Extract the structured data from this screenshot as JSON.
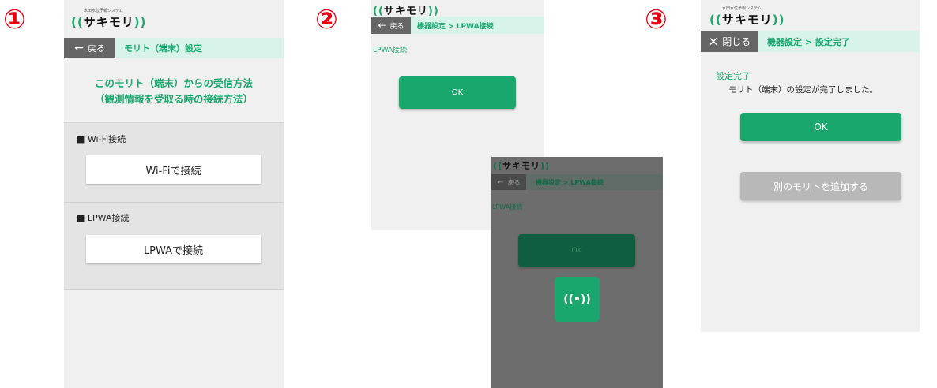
{
  "steps": [
    "①",
    "②",
    "③"
  ],
  "logo": {
    "text": "サキモリ",
    "subtitle": "水田水位予報システム"
  },
  "screen1": {
    "back_label": "戻る",
    "nav_title": "モリト（端末）設定",
    "heading_line1": "このモリト（端末）からの受信方法",
    "heading_line2": "（観測情報を受取る時の接続方法）",
    "wifi_section_label": "Wi-Fi接続",
    "wifi_button": "Wi-Fiで接続",
    "lpwa_section_label": "LPWA接続",
    "lpwa_button": "LPWAで接続"
  },
  "screen2": {
    "back_label": "戻る",
    "nav_title": "機器設定 > LPWA接続",
    "section_label": "LPWA接続",
    "ok_button": "OK"
  },
  "screen2b": {
    "back_label": "戻る",
    "nav_title": "機器設定 > LPWA接続",
    "section_label": "LPWA接続",
    "ok_button": "OK",
    "signal_icon_glyph": "((•))"
  },
  "screen3": {
    "close_label": "閉じる",
    "nav_title": "機器設定 > 設定完了",
    "status_title": "設定完了",
    "status_message": "モリト（端末）の設定が完了しました。",
    "ok_button": "OK",
    "add_button": "別のモリトを追加する"
  },
  "colors": {
    "accent": "#1aa76e",
    "step_number": "#e60012",
    "nav_bg": "#d7f3ea"
  }
}
